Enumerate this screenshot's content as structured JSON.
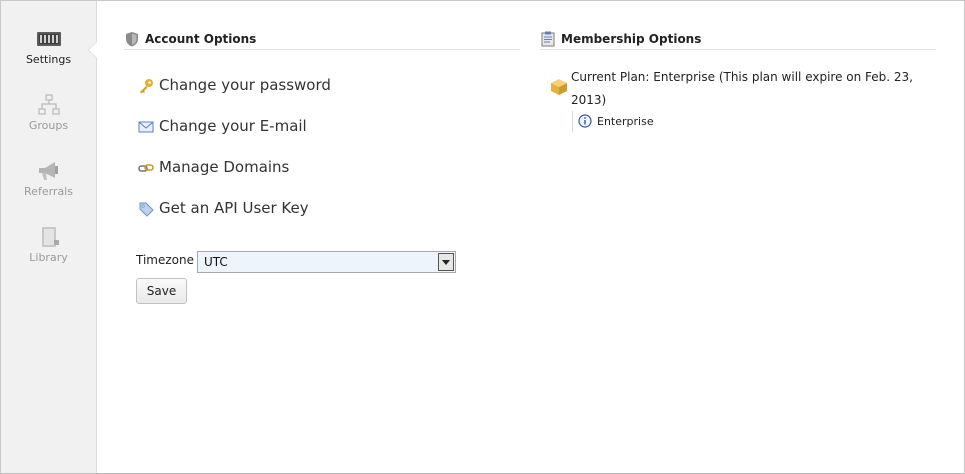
{
  "sidebar": {
    "items": [
      {
        "label": "Settings",
        "icon": "settings-icon",
        "active": true
      },
      {
        "label": "Groups",
        "icon": "groups-icon",
        "active": false
      },
      {
        "label": "Referrals",
        "icon": "megaphone-icon",
        "active": false
      },
      {
        "label": "Library",
        "icon": "library-icon",
        "active": false
      }
    ]
  },
  "account": {
    "title": "Account Options",
    "links": [
      {
        "label": "Change your password",
        "icon": "key-icon"
      },
      {
        "label": "Change your E-mail",
        "icon": "envelope-icon"
      },
      {
        "label": "Manage Domains",
        "icon": "link-icon"
      },
      {
        "label": "Get an API User Key",
        "icon": "tag-icon"
      }
    ],
    "timezone_label": "Timezone",
    "timezone_value": "UTC",
    "save_label": "Save"
  },
  "membership": {
    "title": "Membership Options",
    "plan_text": "Current Plan: Enterprise (This plan will expire on Feb. 23, 2013)",
    "plan_detail": "Enterprise"
  },
  "colors": {
    "sidebar_bg": "#f1f1f1",
    "select_bg": "#eef4fb",
    "key_color": "#e0b030",
    "info_blue": "#2e58b8"
  }
}
